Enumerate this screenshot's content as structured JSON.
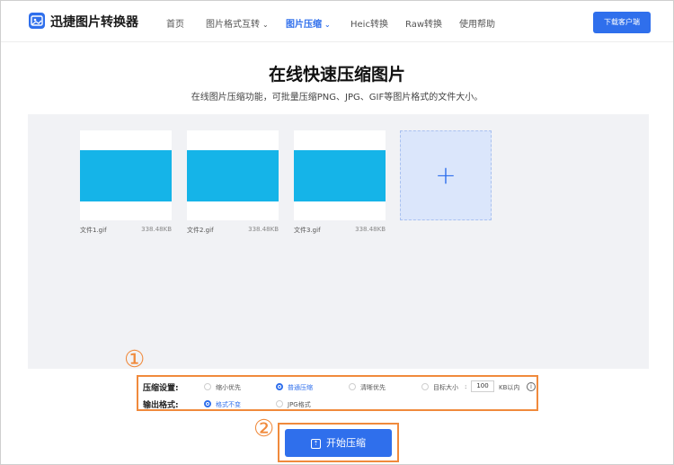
{
  "header": {
    "brand": "迅捷图片转换器",
    "nav": [
      {
        "label": "首页",
        "active": false,
        "dropdown": false
      },
      {
        "label": "图片格式互转",
        "active": false,
        "dropdown": true
      },
      {
        "label": "图片压缩",
        "active": true,
        "dropdown": true
      },
      {
        "label": "Heic转换",
        "active": false,
        "dropdown": false
      },
      {
        "label": "Raw转换",
        "active": false,
        "dropdown": false
      },
      {
        "label": "使用帮助",
        "active": false,
        "dropdown": false
      }
    ],
    "download_button": "下载客户端"
  },
  "main": {
    "title": "在线快速压缩图片",
    "subtitle": "在线图片压缩功能，可批量压缩PNG、JPG、GIF等图片格式的文件大小。"
  },
  "files": [
    {
      "name": "文件1.gif",
      "size": "338.48KB"
    },
    {
      "name": "文件2.gif",
      "size": "338.48KB"
    },
    {
      "name": "文件3.gif",
      "size": "338.48KB"
    }
  ],
  "add_icon": "+",
  "settings": {
    "compression_label": "压缩设置:",
    "compression_options": [
      "缩小优先",
      "普通压缩",
      "清晰优先",
      "目标大小"
    ],
    "selected_compression": "普通压缩",
    "target_size_value": "100",
    "target_size_unit": "KB以内",
    "info_icon": "i",
    "output_label": "输出格式:",
    "output_options": [
      "格式不变",
      "JPG格式"
    ],
    "selected_output": "格式不变"
  },
  "annotations": {
    "one": "①",
    "two": "②"
  },
  "start_button": {
    "label": "开始压缩",
    "icon": "⇡"
  },
  "colors": {
    "accent": "#2f6fec",
    "highlight": "#f08a3c",
    "thumb": "#15b4e8"
  }
}
